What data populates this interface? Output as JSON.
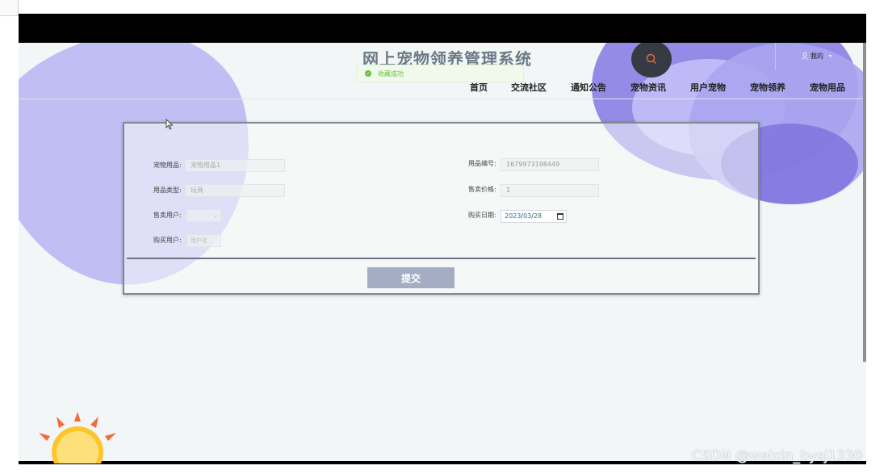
{
  "header": {
    "site_title": "网上宠物领养管理系统",
    "toast_message": "收藏成功",
    "user_menu_label": "我的",
    "search_icon": "search-icon"
  },
  "nav": {
    "items": [
      {
        "label": "首页"
      },
      {
        "label": "交流社区"
      },
      {
        "label": "通知公告"
      },
      {
        "label": "宠物资讯"
      },
      {
        "label": "用户宠物"
      },
      {
        "label": "宠物领养"
      },
      {
        "label": "宠物用品"
      }
    ]
  },
  "form": {
    "product_name": {
      "label": "宠物用品:",
      "value": "宠物用品1"
    },
    "product_no": {
      "label": "用品编号:",
      "value": "1679973198449"
    },
    "product_type": {
      "label": "用品类型:",
      "value": "玩具"
    },
    "sale_price": {
      "label": "售卖价格:",
      "value": "1"
    },
    "seller": {
      "label": "售卖用户:",
      "value": ""
    },
    "purchase_date": {
      "label": "购买日期:",
      "year": "2023",
      "month": "03",
      "day": "28"
    },
    "buyer": {
      "label": "购买用户:",
      "value": "用户名"
    },
    "submit_label": "提交"
  },
  "watermark": "CSDN @weixin_bysj1330",
  "colors": {
    "accent_purple": "#8278e4",
    "toast_green": "#67c23a",
    "submit_bg": "#a5adc4"
  }
}
